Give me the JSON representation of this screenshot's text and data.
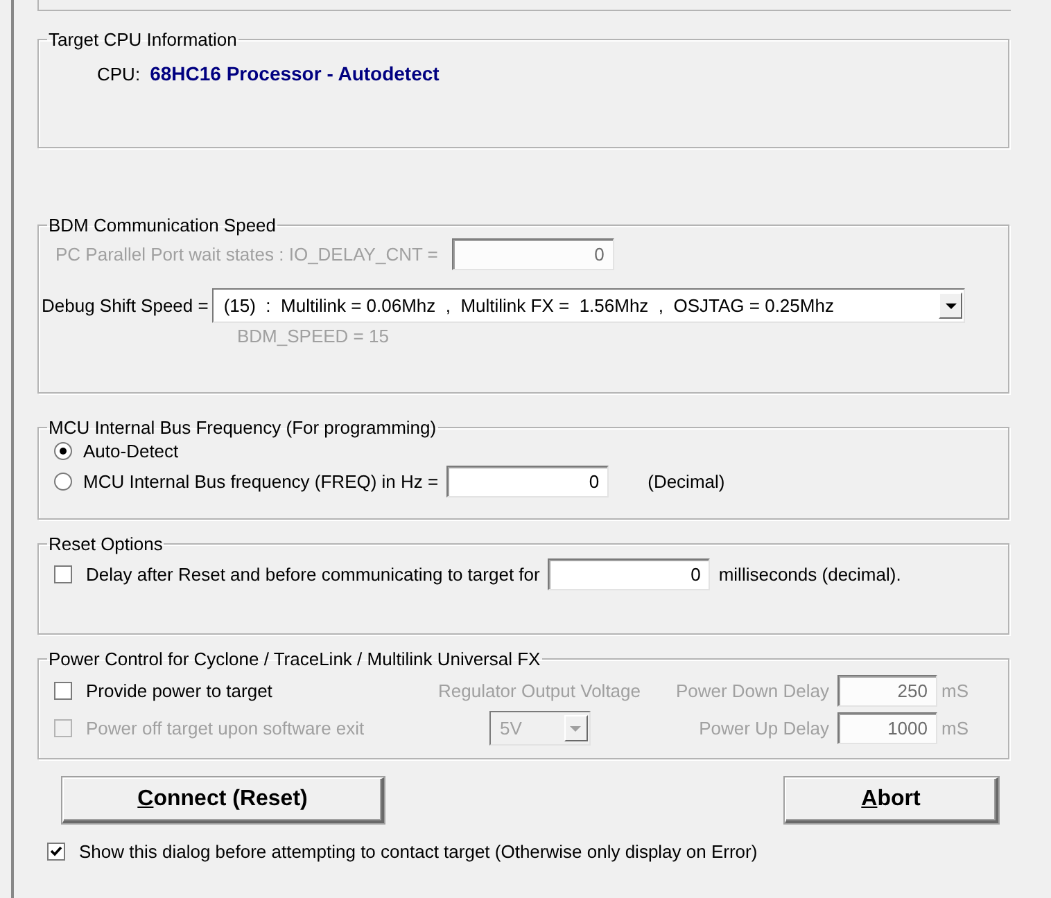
{
  "target_cpu": {
    "title": "Target CPU Information",
    "label": "CPU:",
    "value": "68HC16 Processor - Autodetect"
  },
  "bdm_speed": {
    "title": "BDM Communication Speed",
    "io_delay": {
      "label": "PC Parallel Port wait states : IO_DELAY_CNT =",
      "value": "0",
      "disabled": true
    },
    "debug_shift": {
      "label": "Debug Shift Speed =",
      "value": "(15)  :  Multilink = 0.06Mhz  ,  Multilink FX =  1.56Mhz  ,  OSJTAG = 0.25Mhz"
    },
    "note": {
      "text": "BDM_SPEED = 15",
      "disabled": true
    }
  },
  "bus_frequency": {
    "title": "MCU Internal Bus Frequency (For programming)",
    "options": [
      {
        "label": "Auto-Detect",
        "selected": true
      },
      {
        "label": "MCU Internal Bus frequency (FREQ) in Hz =",
        "selected": false,
        "value": "0",
        "suffix": "(Decimal)"
      }
    ]
  },
  "reset_options": {
    "title": "Reset Options",
    "delay": {
      "label": "Delay after Reset and before communicating to target for",
      "checked": false,
      "value": "0",
      "suffix": "milliseconds (decimal)."
    }
  },
  "power_control": {
    "title": "Power Control for Cyclone / TraceLink / Multilink Universal FX",
    "provide_power": {
      "label": "Provide power to target",
      "checked": false,
      "disabled": false
    },
    "power_off_on_exit": {
      "label": "Power off target upon software exit",
      "checked": false,
      "disabled": true
    },
    "regulator": {
      "label": "Regulator Output Voltage",
      "value": "5V",
      "disabled": true
    },
    "delays": [
      {
        "label": "Power Down Delay",
        "value": "250",
        "unit": "mS",
        "disabled": true
      },
      {
        "label": "Power Up Delay",
        "value": "1000",
        "unit": "mS",
        "disabled": true
      }
    ]
  },
  "buttons": [
    {
      "label": "Connect (Reset)"
    },
    {
      "label": "Abort"
    }
  ],
  "show_dialog": {
    "label": "Show this dialog before attempting to contact target (Otherwise only display on Error)",
    "checked": true
  }
}
